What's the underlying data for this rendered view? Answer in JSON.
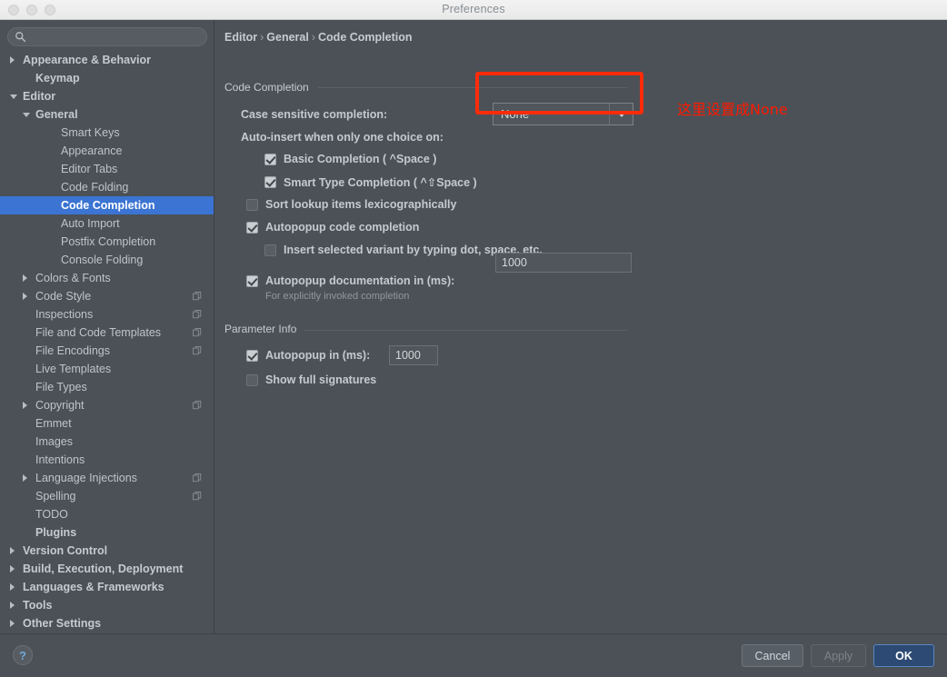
{
  "window": {
    "title": "Preferences",
    "traffic_lights": [
      "close",
      "minimize",
      "zoom"
    ]
  },
  "sidebar": {
    "search": {
      "value": "",
      "placeholder": ""
    },
    "items": [
      {
        "label": "Appearance & Behavior",
        "indent": 0,
        "arrow": "right",
        "bold": true,
        "copy": false,
        "selected": false
      },
      {
        "label": "Keymap",
        "indent": 1,
        "arrow": "none",
        "bold": true,
        "copy": false,
        "selected": false
      },
      {
        "label": "Editor",
        "indent": 0,
        "arrow": "down",
        "bold": true,
        "copy": false,
        "selected": false
      },
      {
        "label": "General",
        "indent": 1,
        "arrow": "down",
        "bold": true,
        "copy": false,
        "selected": false
      },
      {
        "label": "Smart Keys",
        "indent": 3,
        "arrow": "none",
        "bold": false,
        "copy": false,
        "selected": false
      },
      {
        "label": "Appearance",
        "indent": 3,
        "arrow": "none",
        "bold": false,
        "copy": false,
        "selected": false
      },
      {
        "label": "Editor Tabs",
        "indent": 3,
        "arrow": "none",
        "bold": false,
        "copy": false,
        "selected": false
      },
      {
        "label": "Code Folding",
        "indent": 3,
        "arrow": "none",
        "bold": false,
        "copy": false,
        "selected": false
      },
      {
        "label": "Code Completion",
        "indent": 3,
        "arrow": "none",
        "bold": false,
        "copy": false,
        "selected": true
      },
      {
        "label": "Auto Import",
        "indent": 3,
        "arrow": "none",
        "bold": false,
        "copy": false,
        "selected": false
      },
      {
        "label": "Postfix Completion",
        "indent": 3,
        "arrow": "none",
        "bold": false,
        "copy": false,
        "selected": false
      },
      {
        "label": "Console Folding",
        "indent": 3,
        "arrow": "none",
        "bold": false,
        "copy": false,
        "selected": false
      },
      {
        "label": "Colors & Fonts",
        "indent": 1,
        "arrow": "right",
        "bold": false,
        "copy": false,
        "selected": false
      },
      {
        "label": "Code Style",
        "indent": 1,
        "arrow": "right",
        "bold": false,
        "copy": true,
        "selected": false
      },
      {
        "label": "Inspections",
        "indent": 1,
        "arrow": "none",
        "bold": false,
        "copy": true,
        "selected": false
      },
      {
        "label": "File and Code Templates",
        "indent": 1,
        "arrow": "none",
        "bold": false,
        "copy": true,
        "selected": false
      },
      {
        "label": "File Encodings",
        "indent": 1,
        "arrow": "none",
        "bold": false,
        "copy": true,
        "selected": false
      },
      {
        "label": "Live Templates",
        "indent": 1,
        "arrow": "none",
        "bold": false,
        "copy": false,
        "selected": false
      },
      {
        "label": "File Types",
        "indent": 1,
        "arrow": "none",
        "bold": false,
        "copy": false,
        "selected": false
      },
      {
        "label": "Copyright",
        "indent": 1,
        "arrow": "right",
        "bold": false,
        "copy": true,
        "selected": false
      },
      {
        "label": "Emmet",
        "indent": 1,
        "arrow": "none",
        "bold": false,
        "copy": false,
        "selected": false
      },
      {
        "label": "Images",
        "indent": 1,
        "arrow": "none",
        "bold": false,
        "copy": false,
        "selected": false
      },
      {
        "label": "Intentions",
        "indent": 1,
        "arrow": "none",
        "bold": false,
        "copy": false,
        "selected": false
      },
      {
        "label": "Language Injections",
        "indent": 1,
        "arrow": "right",
        "bold": false,
        "copy": true,
        "selected": false
      },
      {
        "label": "Spelling",
        "indent": 1,
        "arrow": "none",
        "bold": false,
        "copy": true,
        "selected": false
      },
      {
        "label": "TODO",
        "indent": 1,
        "arrow": "none",
        "bold": false,
        "copy": false,
        "selected": false
      },
      {
        "label": "Plugins",
        "indent": 1,
        "arrow": "none",
        "bold": true,
        "copy": false,
        "selected": false
      },
      {
        "label": "Version Control",
        "indent": 0,
        "arrow": "right",
        "bold": true,
        "copy": false,
        "selected": false
      },
      {
        "label": "Build, Execution, Deployment",
        "indent": 0,
        "arrow": "right",
        "bold": true,
        "copy": false,
        "selected": false
      },
      {
        "label": "Languages & Frameworks",
        "indent": 0,
        "arrow": "right",
        "bold": true,
        "copy": false,
        "selected": false
      },
      {
        "label": "Tools",
        "indent": 0,
        "arrow": "right",
        "bold": true,
        "copy": false,
        "selected": false
      },
      {
        "label": "Other Settings",
        "indent": 0,
        "arrow": "right",
        "bold": true,
        "copy": false,
        "selected": false
      }
    ]
  },
  "main": {
    "breadcrumb": {
      "part1": "Editor",
      "part2": "General",
      "part3": "Code Completion",
      "separator": "›"
    },
    "section_code_completion": "Code Completion",
    "case_sensitive_label": "Case sensitive completion:",
    "case_sensitive_value": "None",
    "auto_insert_label": "Auto-insert when only one choice on:",
    "checkboxes": [
      {
        "label": "Basic Completion ( ^Space )",
        "checked": true
      },
      {
        "label": "Smart Type Completion ( ^⇧Space )",
        "checked": true
      },
      {
        "label": "Sort lookup items lexicographically",
        "checked": false
      },
      {
        "label": "Autopopup code completion",
        "checked": true
      },
      {
        "label": "Insert selected variant by typing dot, space, etc.",
        "checked": false
      },
      {
        "label": "Autopopup documentation in (ms):",
        "checked": true
      }
    ],
    "autopopup_doc_value": "1000",
    "autopopup_doc_note": "For explicitly invoked completion",
    "section_parameter_info": "Parameter Info",
    "param_checkboxes": [
      {
        "label": "Autopopup in (ms):",
        "checked": true
      },
      {
        "label": "Show full signatures",
        "checked": false
      }
    ],
    "param_autopopup_value": "1000"
  },
  "annotation": {
    "text": "这里设置成None",
    "color": "#fe1a00",
    "highlight_color": "#fe2b0a"
  },
  "footer": {
    "help_label": "?",
    "cancel_label": "Cancel",
    "apply_label": "Apply",
    "ok_label": "OK"
  }
}
